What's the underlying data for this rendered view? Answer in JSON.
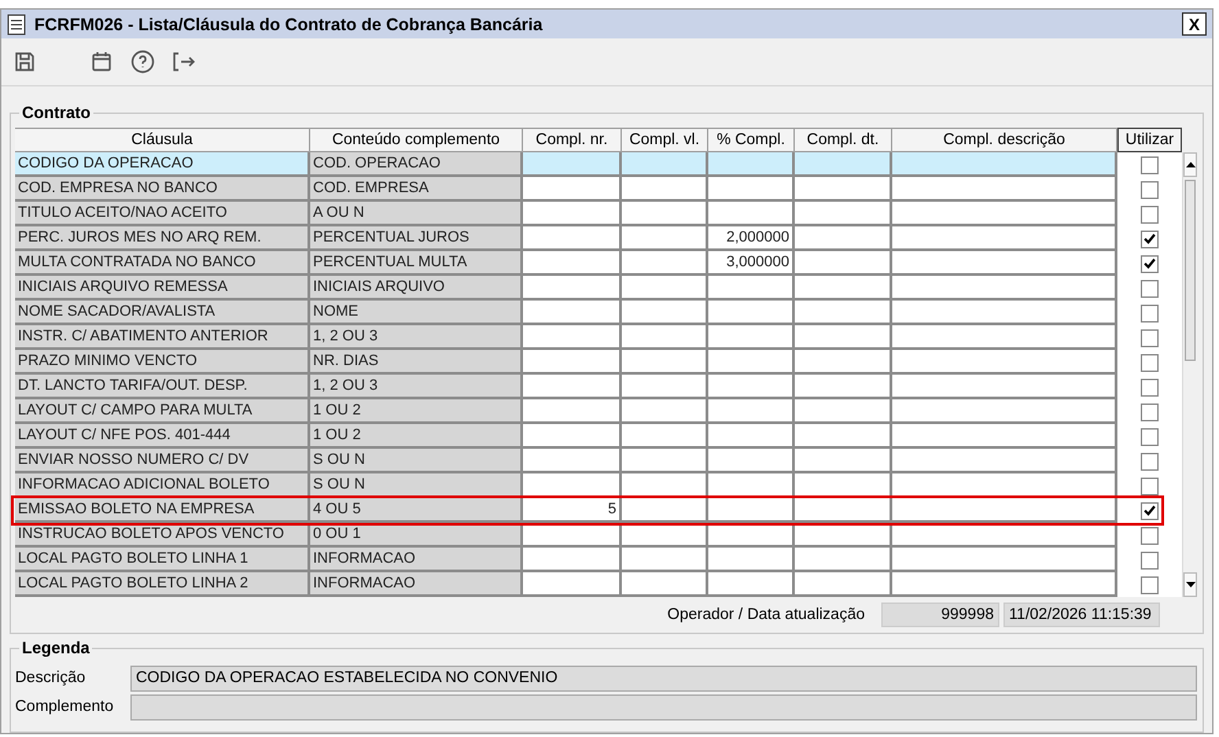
{
  "window": {
    "title": "FCRFM026 - Lista/Cláusula do Contrato de Cobrança Bancária",
    "close": "X"
  },
  "contrato": {
    "title": "Contrato",
    "columns": [
      "Cláusula",
      "Conteúdo complemento",
      "Compl. nr.",
      "Compl. vl.",
      "% Compl.",
      "Compl. dt.",
      "Compl. descrição",
      "Utilizar"
    ],
    "rows": [
      {
        "clause": "CODIGO DA OPERACAO",
        "content": "COD. OPERACAO",
        "use": false,
        "selected": true,
        "highlighted": false
      },
      {
        "clause": "COD. EMPRESA NO BANCO",
        "content": "COD. EMPRESA",
        "use": false,
        "selected": false,
        "highlighted": false
      },
      {
        "clause": "TITULO ACEITO/NAO ACEITO",
        "content": "A OU N",
        "use": false,
        "selected": false,
        "highlighted": false
      },
      {
        "clause": "PERC. JUROS MES NO ARQ REM.",
        "content": "PERCENTUAL JUROS",
        "pct": "2,000000",
        "use": true,
        "selected": false,
        "highlighted": false
      },
      {
        "clause": "MULTA CONTRATADA NO BANCO",
        "content": "PERCENTUAL MULTA",
        "pct": "3,000000",
        "use": true,
        "selected": false,
        "highlighted": false
      },
      {
        "clause": "INICIAIS ARQUIVO REMESSA",
        "content": "INICIAIS ARQUIVO",
        "use": false,
        "selected": false,
        "highlighted": false
      },
      {
        "clause": "NOME SACADOR/AVALISTA",
        "content": "NOME",
        "use": false,
        "selected": false,
        "highlighted": false
      },
      {
        "clause": "INSTR. C/ ABATIMENTO ANTERIOR",
        "content": "1, 2 OU 3",
        "use": false,
        "selected": false,
        "highlighted": false
      },
      {
        "clause": "PRAZO MINIMO VENCTO",
        "content": "NR. DIAS",
        "use": false,
        "selected": false,
        "highlighted": false
      },
      {
        "clause": "DT. LANCTO TARIFA/OUT. DESP.",
        "content": "1, 2 OU 3",
        "use": false,
        "selected": false,
        "highlighted": false
      },
      {
        "clause": "LAYOUT C/ CAMPO PARA MULTA",
        "content": "1 OU 2",
        "use": false,
        "selected": false,
        "highlighted": false
      },
      {
        "clause": "LAYOUT C/ NFE POS. 401-444",
        "content": "1 OU 2",
        "use": false,
        "selected": false,
        "highlighted": false
      },
      {
        "clause": "ENVIAR NOSSO NUMERO C/ DV",
        "content": "S OU N",
        "use": false,
        "selected": false,
        "highlighted": false
      },
      {
        "clause": "INFORMACAO ADICIONAL BOLETO",
        "content": "S OU N",
        "use": false,
        "selected": false,
        "highlighted": false
      },
      {
        "clause": "EMISSAO BOLETO NA EMPRESA",
        "content": "4 OU 5",
        "nr": "5",
        "use": true,
        "selected": false,
        "highlighted": true
      },
      {
        "clause": "INSTRUCAO BOLETO APOS VENCTO",
        "content": "0 OU 1",
        "use": false,
        "selected": false,
        "highlighted": false
      },
      {
        "clause": "LOCAL PAGTO BOLETO LINHA 1",
        "content": "INFORMACAO",
        "use": false,
        "selected": false,
        "highlighted": false
      },
      {
        "clause": "LOCAL PAGTO BOLETO LINHA 2",
        "content": "INFORMACAO",
        "use": false,
        "selected": false,
        "highlighted": false
      }
    ],
    "operator_label": "Operador / Data atualização",
    "operator": "999998",
    "updated": "11/02/2026 11:15:39"
  },
  "legenda": {
    "title": "Legenda",
    "description_label": "Descrição",
    "description": "CODIGO DA OPERACAO ESTABELECIDA NO CONVENIO",
    "complement_label": "Complemento"
  }
}
